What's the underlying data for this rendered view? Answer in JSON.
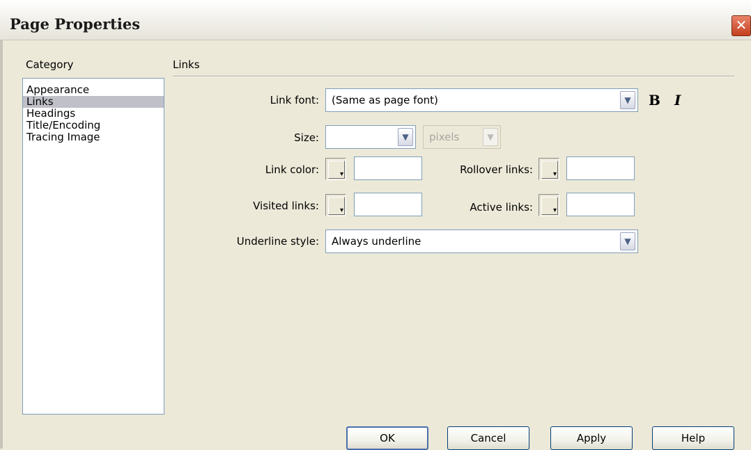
{
  "window": {
    "title": "Page Properties",
    "close_glyph": "✕"
  },
  "category": {
    "label": "Category",
    "items": [
      "Appearance",
      "Links",
      "Headings",
      "Title/Encoding",
      "Tracing Image"
    ],
    "selected": "Links"
  },
  "section": {
    "title": "Links"
  },
  "form": {
    "link_font": {
      "label": "Link font:",
      "value": "(Same as page font)"
    },
    "bold_label": "B",
    "italic_label": "I",
    "size": {
      "label": "Size:",
      "value": "",
      "unit": "pixels"
    },
    "link_color": {
      "label": "Link color:",
      "value": ""
    },
    "rollover_links": {
      "label": "Rollover links:",
      "value": ""
    },
    "visited_links": {
      "label": "Visited links:",
      "value": ""
    },
    "active_links": {
      "label": "Active links:",
      "value": ""
    },
    "underline_style": {
      "label": "Underline style:",
      "value": "Always underline"
    }
  },
  "icons": {
    "dropdown_arrow": "chevron-down-icon",
    "color_picker": "color-swatch-icon"
  },
  "buttons": {
    "ok": "OK",
    "cancel": "Cancel",
    "apply": "Apply",
    "help": "Help"
  }
}
